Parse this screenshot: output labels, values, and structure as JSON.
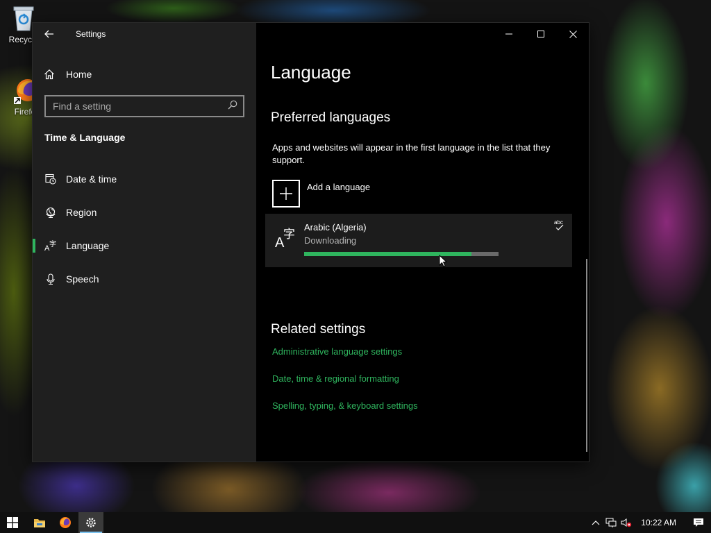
{
  "desktop": {
    "icons": [
      {
        "label": "Recycle"
      },
      {
        "label": "Firefo"
      }
    ]
  },
  "window": {
    "app_title": "Settings",
    "sidebar": {
      "home_label": "Home",
      "search_placeholder": "Find a setting",
      "section_title": "Time & Language",
      "items": [
        {
          "label": "Date & time",
          "icon": "clock-calendar-icon"
        },
        {
          "label": "Region",
          "icon": "globe-icon"
        },
        {
          "label": "Language",
          "icon": "language-icon",
          "active": true
        },
        {
          "label": "Speech",
          "icon": "microphone-icon"
        }
      ]
    },
    "main": {
      "page_title": "Language",
      "preferred_heading": "Preferred languages",
      "preferred_description": "Apps and websites will appear in the first language in the list that they support.",
      "add_language_label": "Add a language",
      "language_card": {
        "name": "Arabic (Algeria)",
        "status": "Downloading",
        "progress": 0.86,
        "spell_icon_text": "abc"
      },
      "related_heading": "Related settings",
      "links": [
        "Administrative language settings",
        "Date, time & regional formatting",
        "Spelling, typing, & keyboard settings"
      ]
    }
  },
  "taskbar": {
    "clock": "10:22 AM"
  },
  "colors": {
    "accent": "#2fb55e",
    "sidebar_bg": "#1f1f1f",
    "main_bg": "#000000"
  }
}
